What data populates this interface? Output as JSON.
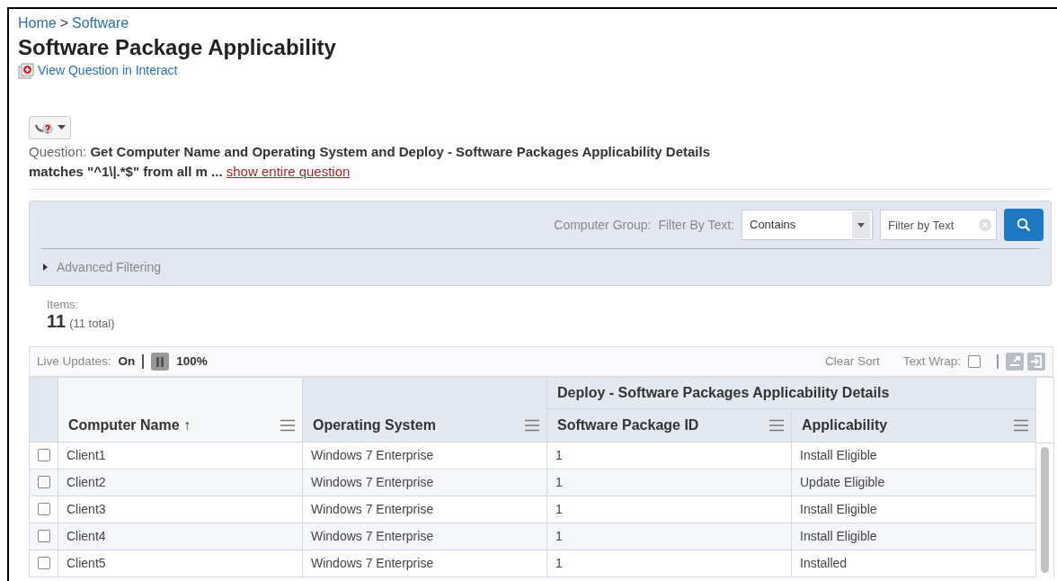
{
  "breadcrumb": {
    "items": [
      {
        "label": "Home"
      },
      {
        "label": "Software"
      }
    ],
    "separator": ">"
  },
  "title": "Software Package Applicability",
  "interact_link": "View Question in Interact",
  "question": {
    "label": "Question:",
    "text": "Get Computer Name and Operating System and Deploy - Software Packages Applicability Details matches \"^1\\|.*$\" from all m ...",
    "link": "show entire question"
  },
  "filter": {
    "computer_group_label": "Computer Group:",
    "filter_label": "Filter By Text:",
    "select_value": "Contains",
    "text_placeholder": "Filter by Text",
    "advanced_label": "Advanced Filtering",
    "advanced_expanded": false
  },
  "items": {
    "label": "Items:",
    "count": "11",
    "total": "(11 total)"
  },
  "toolbar": {
    "live_updates_label": "Live Updates:",
    "live_updates_value": "On",
    "paused": false,
    "percent": "100%",
    "clear_sort": "Clear Sort",
    "text_wrap_label": "Text Wrap:",
    "text_wrap_checked": false
  },
  "table": {
    "group_header": "Deploy - Software Packages Applicability Details",
    "columns": [
      {
        "label": "Computer Name",
        "sort_mark": "↑",
        "sorted": true,
        "grouped": false
      },
      {
        "label": "Operating System",
        "sorted": false,
        "grouped": false
      },
      {
        "label": "Software Package ID",
        "sorted": false,
        "grouped": true
      },
      {
        "label": "Applicability",
        "sorted": false,
        "grouped": true
      }
    ],
    "rows": [
      {
        "selected": false,
        "cells": [
          "Client1",
          "Windows 7 Enterprise",
          "1",
          "Install Eligible"
        ]
      },
      {
        "selected": false,
        "cells": [
          "Client2",
          "Windows 7 Enterprise",
          "1",
          "Update Eligible"
        ]
      },
      {
        "selected": false,
        "cells": [
          "Client3",
          "Windows 7 Enterprise",
          "1",
          "Install Eligible"
        ]
      },
      {
        "selected": false,
        "cells": [
          "Client4",
          "Windows 7 Enterprise",
          "1",
          "Install Eligible"
        ]
      },
      {
        "selected": false,
        "cells": [
          "Client5",
          "Windows 7 Enterprise",
          "1",
          "Installed"
        ]
      }
    ]
  }
}
